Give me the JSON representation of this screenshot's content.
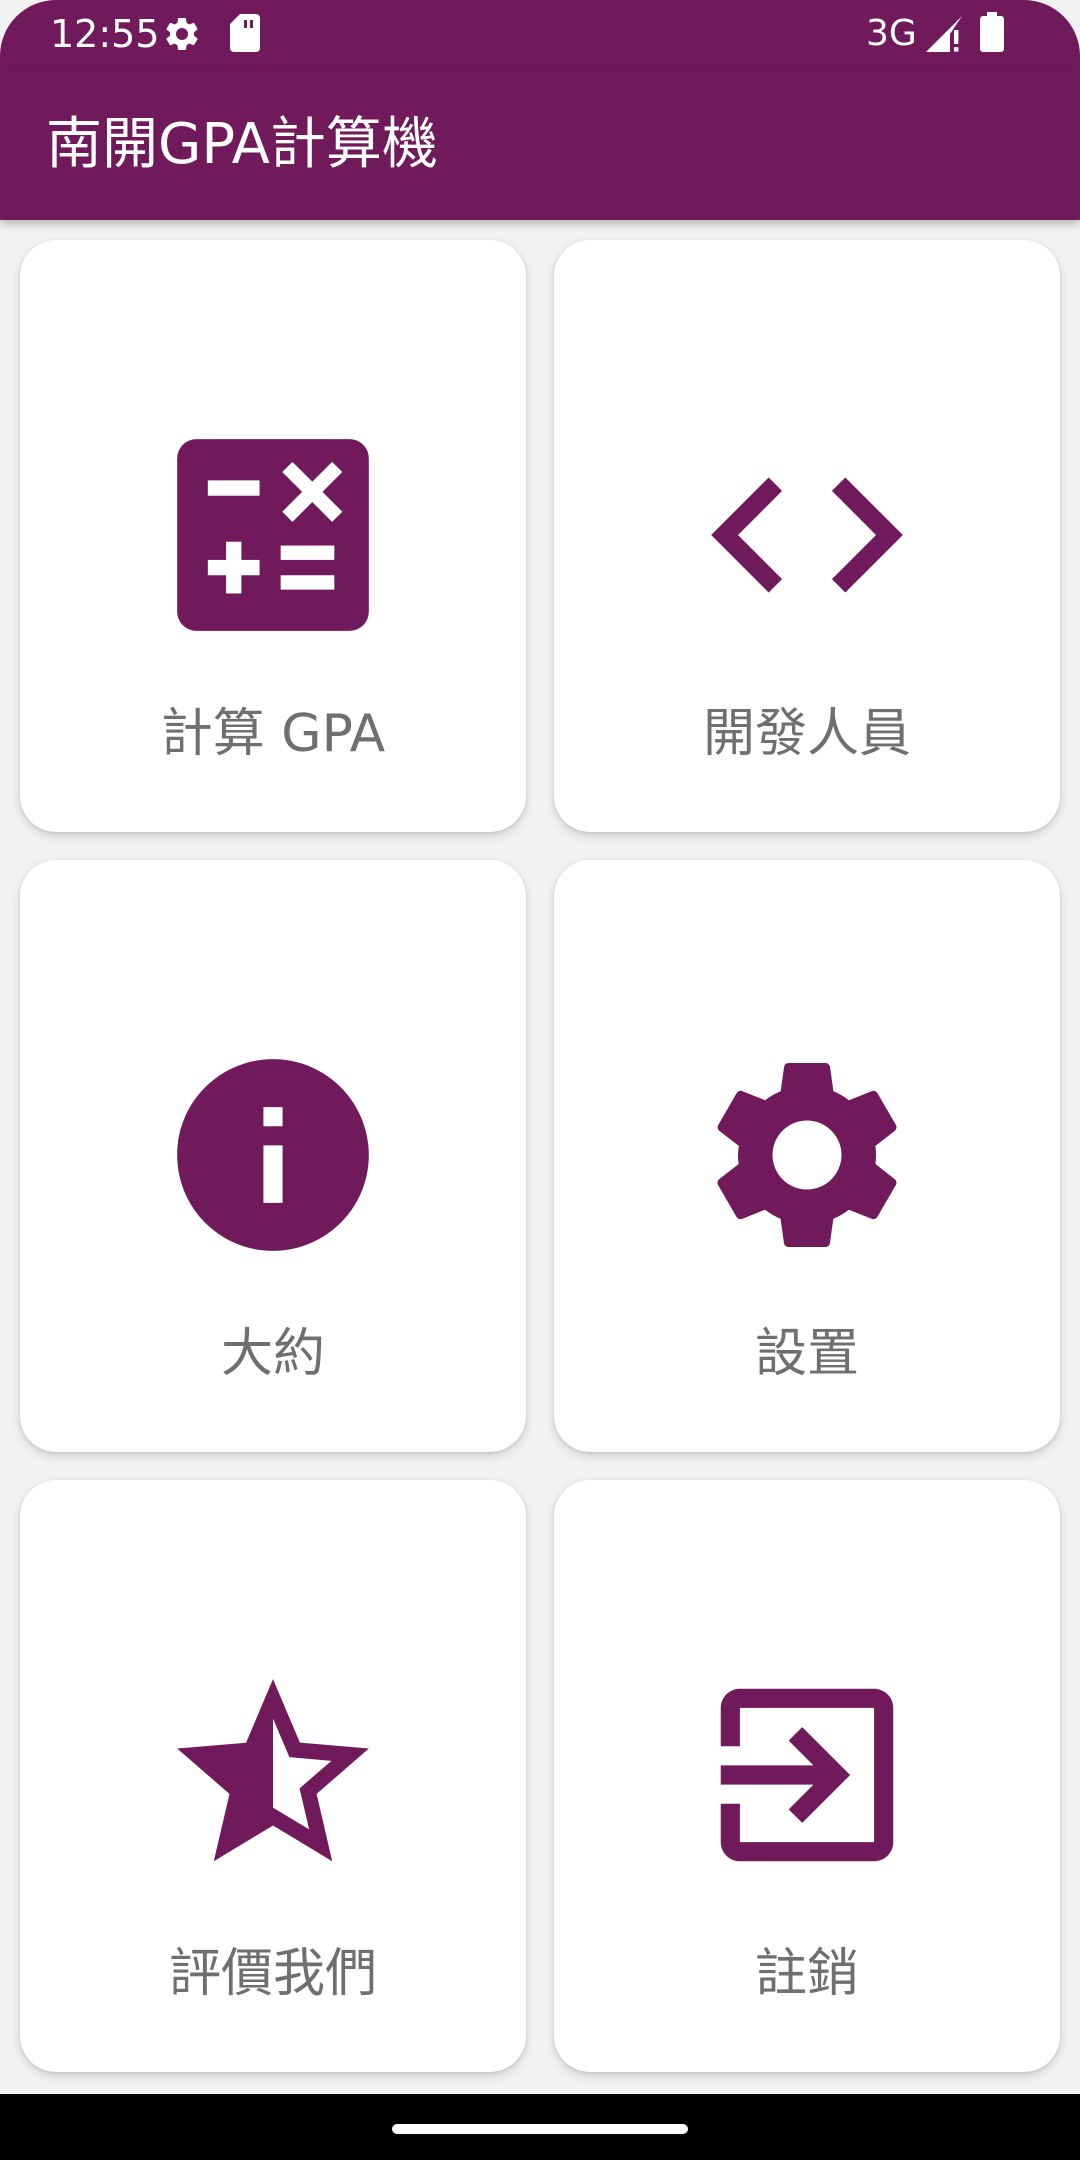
{
  "status_bar": {
    "time": "12:55",
    "network": "3G",
    "icons": [
      "gear-icon",
      "sd-card-icon",
      "signal-icon",
      "battery-icon"
    ]
  },
  "app_bar": {
    "title": "南開GPA計算機"
  },
  "menu": {
    "items": [
      {
        "label": "計算 GPA",
        "icon": "calculator-icon"
      },
      {
        "label": "開發人員",
        "icon": "code-icon"
      },
      {
        "label": "大約",
        "icon": "info-icon"
      },
      {
        "label": "設置",
        "icon": "settings-icon"
      },
      {
        "label": "評價我們",
        "icon": "star-half-icon"
      },
      {
        "label": "註銷",
        "icon": "logout-icon"
      }
    ]
  },
  "colors": {
    "primary": "#701a5b",
    "card_background": "#ffffff",
    "label_text": "#6f6f6f",
    "page_background": "#f2f2f2"
  }
}
